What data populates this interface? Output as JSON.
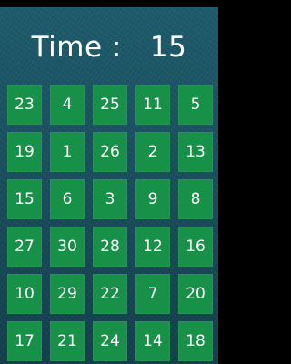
{
  "header": {
    "time_label": "Time :",
    "time_value": "15"
  },
  "colors": {
    "background": "#1a4f5f",
    "tile": "#179048",
    "text": "#ffffff"
  },
  "grid": {
    "rows": [
      [
        "23",
        "4",
        "25",
        "11",
        "5"
      ],
      [
        "19",
        "1",
        "26",
        "2",
        "13"
      ],
      [
        "15",
        "6",
        "3",
        "9",
        "8"
      ],
      [
        "27",
        "30",
        "28",
        "12",
        "16"
      ],
      [
        "10",
        "29",
        "22",
        "7",
        "20"
      ],
      [
        "17",
        "21",
        "24",
        "14",
        "18"
      ]
    ]
  }
}
